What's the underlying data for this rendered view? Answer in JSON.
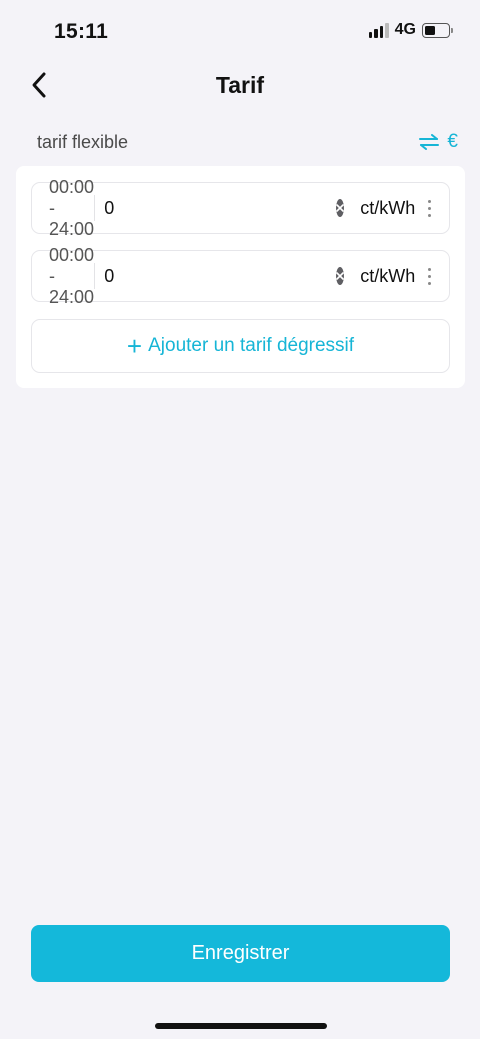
{
  "status_bar": {
    "time": "15:11",
    "network": "4G"
  },
  "header": {
    "title": "Tarif",
    "back_icon": "chevron-left-icon"
  },
  "section": {
    "label": "tarif flexible",
    "toggle_icon": "swap-arrows-icon",
    "currency_symbol": "€"
  },
  "tariffs": [
    {
      "time_range": "00:00 - 24:00",
      "price": "0",
      "unit": "ct/kWh"
    },
    {
      "time_range": "00:00 - 24:00",
      "price": "0",
      "unit": "ct/kWh"
    }
  ],
  "add_button": {
    "plus": "+",
    "label": "Ajouter un tarif dégressif"
  },
  "save_button": {
    "label": "Enregistrer"
  },
  "colors": {
    "accent": "#14b8da",
    "background": "#f4f3f8",
    "card": "#ffffff"
  }
}
